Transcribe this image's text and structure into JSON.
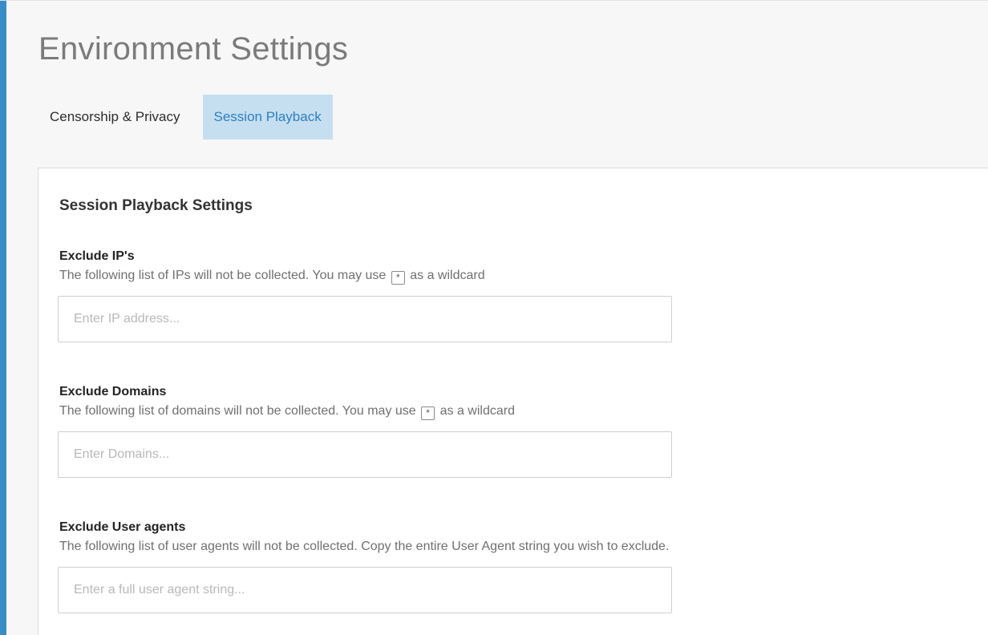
{
  "page": {
    "title": "Environment Settings"
  },
  "tabs": [
    {
      "label": "Censorship & Privacy",
      "active": false
    },
    {
      "label": "Session Playback",
      "active": true
    }
  ],
  "section": {
    "title": "Session Playback Settings"
  },
  "wildcard_symbol": "*",
  "fields": {
    "ips": {
      "label": "Exclude IP's",
      "help_prefix": "The following list of IPs will not be collected. You may use",
      "help_suffix": "as a wildcard",
      "placeholder": "Enter IP address...",
      "value": ""
    },
    "domains": {
      "label": "Exclude Domains",
      "help_prefix": "The following list of domains will not be collected. You may use",
      "help_suffix": "as a wildcard",
      "placeholder": "Enter Domains...",
      "value": ""
    },
    "user_agents": {
      "label": "Exclude User agents",
      "help": "The following list of user agents will not be collected. Copy the entire User Agent string you wish to exclude.",
      "placeholder": "Enter a full user agent string...",
      "value": ""
    }
  },
  "colors": {
    "accent": "#3a8cc7",
    "active_tab_bg": "#c5dff1",
    "active_tab_text": "#2f7fc0"
  }
}
